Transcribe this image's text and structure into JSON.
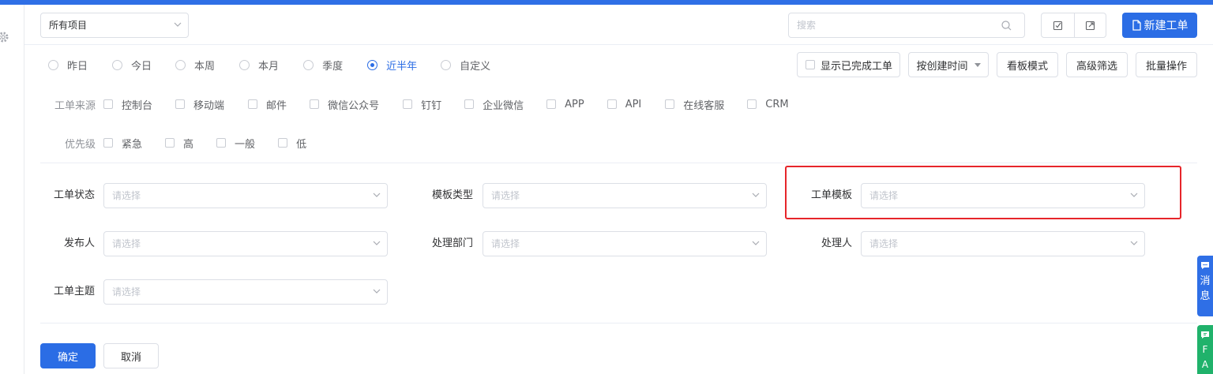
{
  "header": {
    "project_select": "所有项目",
    "search_placeholder": "搜索",
    "new_button": "新建工单"
  },
  "time_filters": [
    {
      "label": "昨日",
      "checked": false
    },
    {
      "label": "今日",
      "checked": false
    },
    {
      "label": "本周",
      "checked": false
    },
    {
      "label": "本月",
      "checked": false
    },
    {
      "label": "季度",
      "checked": false
    },
    {
      "label": "近半年",
      "checked": true
    },
    {
      "label": "自定义",
      "checked": false
    }
  ],
  "toolbar": {
    "show_completed": "显示已完成工单",
    "sort_by": "按创建时间",
    "kanban": "看板模式",
    "advanced": "高级筛选",
    "batch": "批量操作"
  },
  "source": {
    "label": "工单来源",
    "items": [
      "控制台",
      "移动端",
      "邮件",
      "微信公众号",
      "钉钉",
      "企业微信",
      "APP",
      "API",
      "在线客服",
      "CRM"
    ]
  },
  "priority": {
    "label": "优先级",
    "items": [
      "紧急",
      "高",
      "一般",
      "低"
    ]
  },
  "fields": {
    "status": {
      "label": "工单状态",
      "placeholder": "请选择"
    },
    "template_type": {
      "label": "模板类型",
      "placeholder": "请选择"
    },
    "template": {
      "label": "工单模板",
      "placeholder": "请选择"
    },
    "publisher": {
      "label": "发布人",
      "placeholder": "请选择"
    },
    "dept": {
      "label": "处理部门",
      "placeholder": "请选择"
    },
    "handler": {
      "label": "处理人",
      "placeholder": "请选择"
    },
    "subject": {
      "label": "工单主题",
      "placeholder": "请选择"
    }
  },
  "actions": {
    "confirm": "确定",
    "cancel": "取消"
  },
  "float": {
    "message": [
      "消",
      "息"
    ],
    "faq": [
      "F",
      "A"
    ]
  },
  "colors": {
    "primary": "#2b6de5",
    "topbar": "#2f6fe6",
    "highlight": "#e6252a",
    "faq": "#20b26b"
  }
}
